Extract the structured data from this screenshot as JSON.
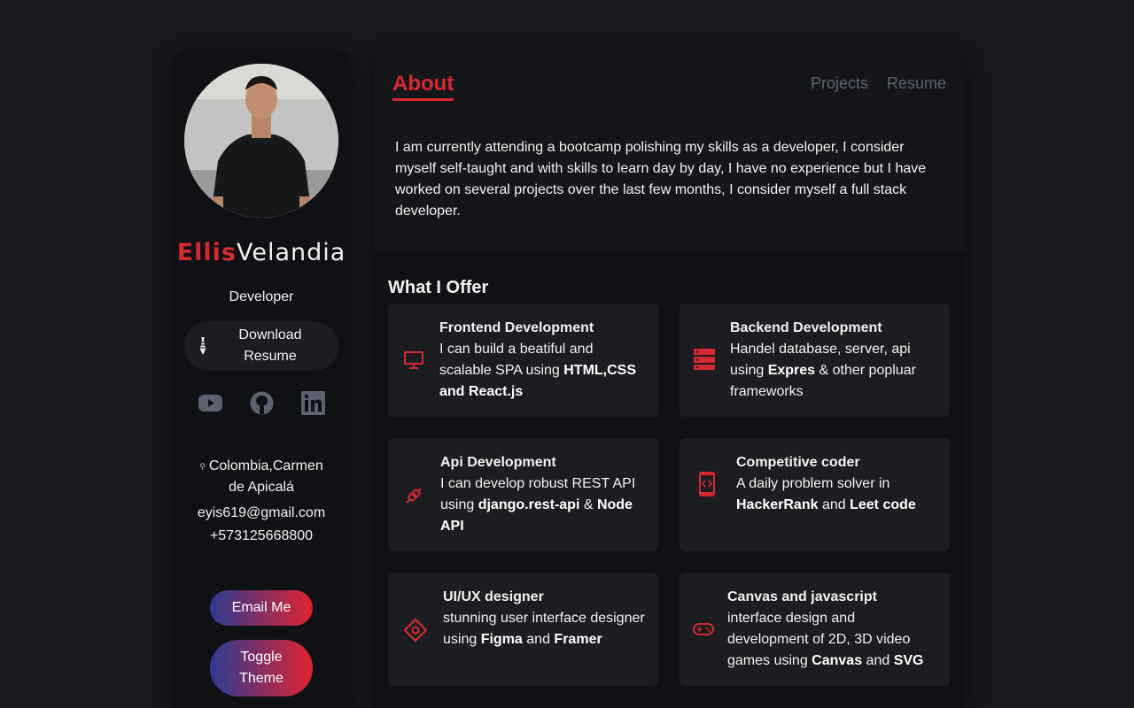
{
  "profile": {
    "first_name": "Ellis",
    "last_name": "Velandia",
    "role": "Developer",
    "resume_button": [
      "Download",
      "Resume"
    ],
    "socials": [
      "youtube-icon",
      "github-icon",
      "linkedin-icon"
    ],
    "location": [
      "Colombia,Carmen",
      "de Apicalá"
    ],
    "email": "eyis619@gmail.com",
    "phone": "+573125668800",
    "email_button": "Email Me",
    "toggle_button": [
      "Toggle",
      "Theme"
    ]
  },
  "header": {
    "title": "About",
    "nav": [
      "Projects",
      "Resume"
    ]
  },
  "about": {
    "text": "I am currently attending a bootcamp polishing my skills as a developer, I consider myself self-taught and with skills to learn day by day, I have no experience but I have worked on several projects over the last few months, I consider myself a full stack developer."
  },
  "offer": {
    "title": "What I Offer",
    "cards": [
      {
        "title": "Frontend Development",
        "icon": "monitor-icon",
        "desc": [
          "I can build a beatiful and scalable SPA using ",
          "HTML,CSS and React.js",
          ""
        ]
      },
      {
        "title": "Backend Development",
        "icon": "server-icon",
        "desc": [
          "Handel database, server, api using ",
          "Expres",
          " & other popluar frameworks"
        ]
      },
      {
        "title": "Api Development",
        "icon": "plug-icon",
        "desc": [
          "I can develop robust REST API using ",
          "django.rest-api",
          " & ",
          "Node API"
        ]
      },
      {
        "title": "Competitive coder",
        "icon": "phone-code-icon",
        "desc": [
          "A daily problem solver in ",
          "HackerRank",
          " and ",
          "Leet code"
        ]
      },
      {
        "title": "UI/UX designer",
        "icon": "design-icon",
        "desc": [
          "stunning user interface designer using ",
          "Figma",
          " and ",
          "Framer"
        ]
      },
      {
        "title": "Canvas and javascript",
        "icon": "gamepad-icon",
        "desc": [
          "interface design and development of 2D, 3D video games using ",
          "Canvas",
          " and ",
          "SVG"
        ]
      }
    ]
  },
  "colors": {
    "accent": "#d42a2f",
    "background": "#18191c",
    "panel": "#101114",
    "card": "#1c1d21"
  }
}
